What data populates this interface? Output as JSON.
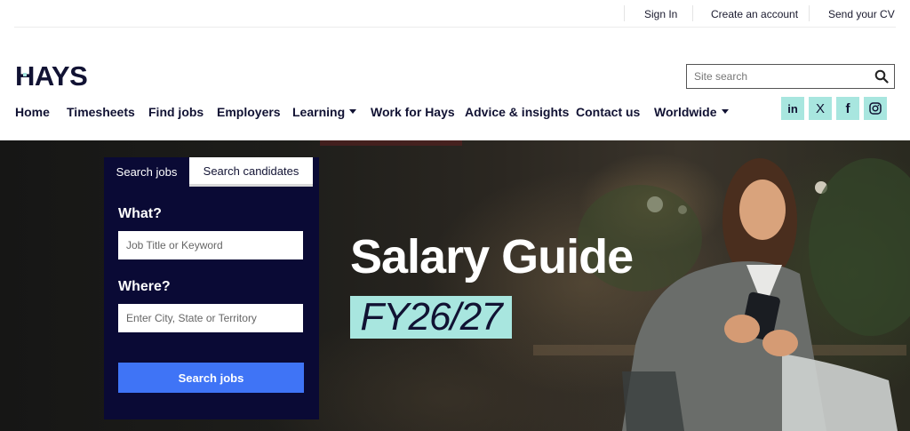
{
  "utility": {
    "sign_in": "Sign In",
    "create_account": "Create an account",
    "send_cv": "Send your CV"
  },
  "brand": {
    "logo_text": "HAYS",
    "colors": {
      "navy": "#111233",
      "accent": "#a8e6df",
      "button": "#3f74f6",
      "panel": "#0a0a35"
    }
  },
  "site_search": {
    "placeholder": "Site search",
    "icon": "search-icon"
  },
  "nav": {
    "items": [
      {
        "label": "Home"
      },
      {
        "label": "Timesheets"
      },
      {
        "label": "Find jobs"
      },
      {
        "label": "Employers"
      },
      {
        "label": "Learning",
        "dropdown": true
      },
      {
        "label": "Work for Hays"
      },
      {
        "label": "Advice & insights"
      },
      {
        "label": "Contact us"
      },
      {
        "label": "Worldwide",
        "dropdown": true
      }
    ]
  },
  "social": [
    {
      "label": "in",
      "icon": "linkedin-icon"
    },
    {
      "label": "X",
      "icon": "x-twitter-icon"
    },
    {
      "label": "f",
      "icon": "facebook-icon"
    },
    {
      "label": "instagram",
      "icon": "instagram-icon"
    }
  ],
  "search_panel": {
    "tabs": [
      {
        "label": "Search jobs",
        "active": true
      },
      {
        "label": "Search candidates",
        "active": false
      }
    ],
    "what_label": "What?",
    "what_placeholder": "Job Title or Keyword",
    "where_label": "Where?",
    "where_placeholder": "Enter City, State or Territory",
    "button_label": "Search jobs"
  },
  "hero": {
    "title": "Salary Guide",
    "badge": "FY26/27"
  }
}
